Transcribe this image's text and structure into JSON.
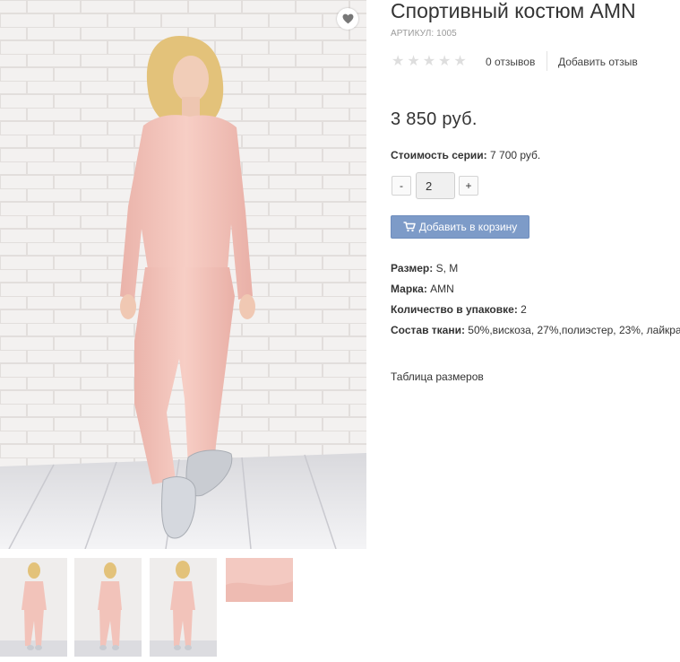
{
  "product": {
    "title": "Спортивный костюм AMN",
    "sku_label": "АРТИКУЛ: 1005",
    "rating": 0,
    "stars": 5,
    "reviews_count": "0 отзывов",
    "add_review": "Добавить отзыв",
    "price": "3 850 руб."
  },
  "series": {
    "label": "Стоимость серии:",
    "value": "7 700 руб."
  },
  "quantity": {
    "minus": "-",
    "value": "2",
    "plus": "+"
  },
  "cart": {
    "button_label": "Добавить в корзину"
  },
  "properties": [
    {
      "label": "Размер:",
      "value": "S, M"
    },
    {
      "label": "Марка:",
      "value": "AMN"
    },
    {
      "label": "Количество в упаковке:",
      "value": "2"
    },
    {
      "label": "Состав ткани:",
      "value": "50%,вискоза, 27%,полиэстер, 23%, лайкра"
    }
  ],
  "size_table_link": "Таблица размеров",
  "icons": {
    "wishlist": "heart-icon",
    "cart": "shopping-cart-icon",
    "rating": "star-icon"
  },
  "colors": {
    "accent_button": "#7d9bc8",
    "garment_pink": "#f4c6bd",
    "star_empty": "#dedede"
  }
}
